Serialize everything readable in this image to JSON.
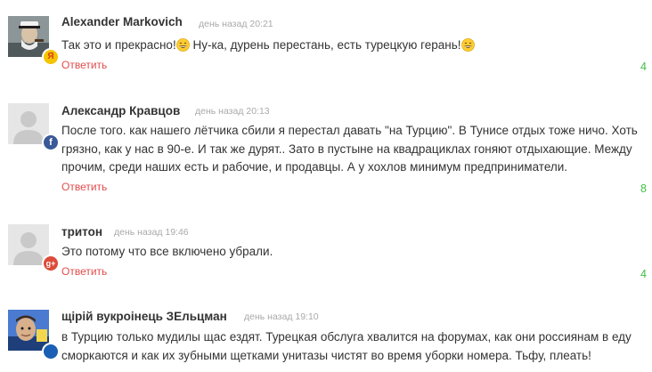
{
  "comments": [
    {
      "author": "Alexander Markovich",
      "time": "день назад 20:21",
      "text_parts": [
        "Так это и прекрасно!",
        " Ну-ка, дурень перестань, есть турецкую герань!"
      ],
      "emoji": "grinning-emoji",
      "reply": "Ответить",
      "likes": "4",
      "badge_icon": "yandex-icon",
      "badge_letter": "Я",
      "badge_color": "#f5c400"
    },
    {
      "author": "Александр Кравцов",
      "time": "день назад 20:13",
      "text": "После того. как нашего лётчика сбили я перестал давать \"на Турцию\". В Тунисе отдых тоже ничо. Хоть грязно, как у нас в 90-е. И так же дурят.. Зато в пустыне на квадрациклах гоняют отдыхающие. Между прочим, среди наших есть и рабочие, и продавцы. А у хохлов минимум предприниматели.",
      "reply": "Ответить",
      "likes": "8",
      "badge_icon": "facebook-icon",
      "badge_letter": "f",
      "badge_color": "#3b5998"
    },
    {
      "author": "тритон",
      "time": "день назад 19:46",
      "text": "Это потому что все включено убрали.",
      "reply": "Ответить",
      "likes": "4",
      "badge_icon": "google-plus-icon",
      "badge_letter": "g+",
      "badge_color": "#dd4b39"
    },
    {
      "author": "щірій вукроінець ЗЕльцман",
      "time": "день назад 19:10",
      "text": "в Турцию только мудилы щас ездят. Турецкая обслуга хвалится на форумах, как они россиянам в еду сморкаются и как их зубными щетками унитазы чистят во время уборки номера. Тьфу, плеать!",
      "badge_icon": "unknown-badge-icon",
      "badge_letter": "",
      "badge_color": "#1a5fb4"
    }
  ],
  "colors": {
    "reply": "#e14b4b",
    "likes": "#3fbf45",
    "time": "#a9a9a9"
  }
}
